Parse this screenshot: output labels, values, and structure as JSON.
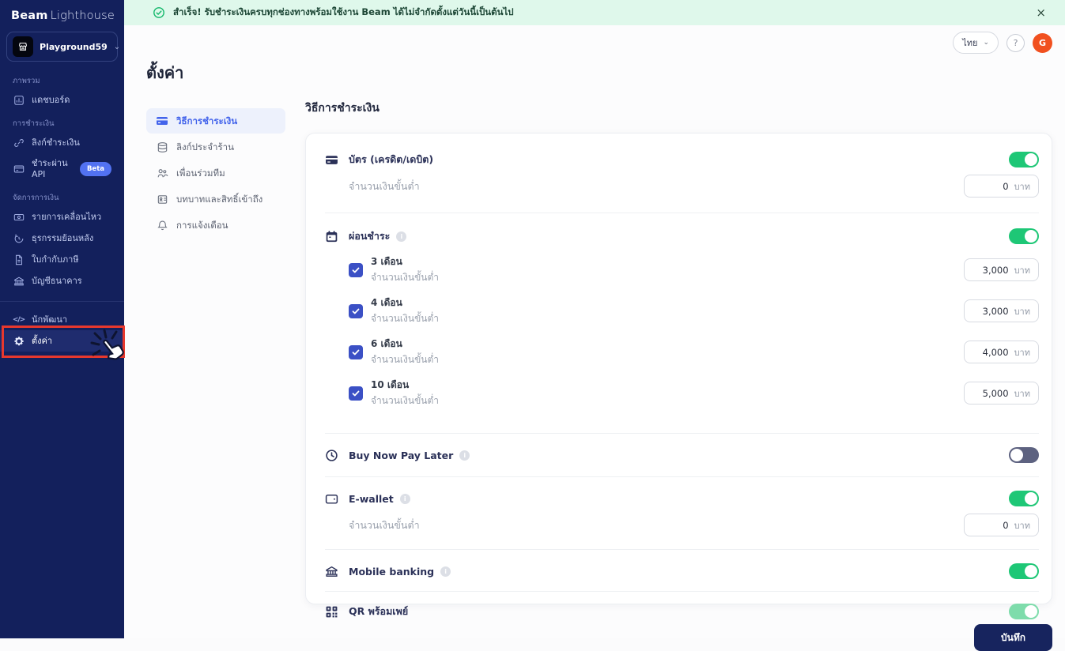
{
  "sidebar": {
    "brand": {
      "name_bold": "Beam",
      "name_light": "Lighthouse"
    },
    "workspace": {
      "name": "Playground59"
    },
    "sections": [
      {
        "label": "ภาพรวม",
        "items": [
          {
            "label": "แดชบอร์ด"
          }
        ]
      },
      {
        "label": "การชำระเงิน",
        "items": [
          {
            "label": "ลิงก์ชำระเงิน"
          },
          {
            "label": "ชำระผ่าน API",
            "badge": "Beta"
          }
        ]
      },
      {
        "label": "จัดการการเงิน",
        "items": [
          {
            "label": "รายการเคลื่อนไหว"
          },
          {
            "label": "ธุรกรรมย้อนหลัง"
          },
          {
            "label": "ใบกำกับภาษี"
          },
          {
            "label": "บัญชีธนาคาร"
          }
        ]
      }
    ],
    "footer_items": [
      {
        "label": "นักพัฒนา"
      },
      {
        "label": "ตั้งค่า",
        "active": true
      }
    ]
  },
  "banner": {
    "message": "สำเร็จ! รับชำระเงินครบทุกช่องทางพร้อมใช้งาน Beam ได้ไม่จำกัดตั้งแต่วันนี้เป็นต้นไป",
    "close": "×"
  },
  "topbar": {
    "language": "ไทย",
    "help": "?",
    "avatar_initial": "G"
  },
  "page": {
    "title": "ตั้งค่า"
  },
  "settings_nav": {
    "items": [
      {
        "label": "วิธีการชำระเงิน",
        "active": true
      },
      {
        "label": "ลิงก์ประจำร้าน"
      },
      {
        "label": "เพื่อนร่วมทีม"
      },
      {
        "label": "บทบาทและสิทธิ์เข้าถึง"
      },
      {
        "label": "การแจ้งเตือน"
      }
    ]
  },
  "payment_settings": {
    "heading": "วิธีการชำระเงิน",
    "min_amount_label": "จำนวนเงินขั้นต่ำ",
    "currency": "บาท",
    "card": {
      "title": "บัตร (เครดิต/เดบิต)",
      "min_amount": "0",
      "enabled": true
    },
    "installment": {
      "title": "ผ่อนชำระ",
      "enabled": true,
      "options": [
        {
          "label": "3 เดือน",
          "min_amount": "3,000",
          "checked": true
        },
        {
          "label": "4 เดือน",
          "min_amount": "3,000",
          "checked": true
        },
        {
          "label": "6 เดือน",
          "min_amount": "4,000",
          "checked": true
        },
        {
          "label": "10 เดือน",
          "min_amount": "5,000",
          "checked": true
        }
      ]
    },
    "bnpl": {
      "title": "Buy Now Pay Later",
      "enabled": false
    },
    "ewallet": {
      "title": "E-wallet",
      "min_amount": "0",
      "enabled": true
    },
    "mobile_banking": {
      "title": "Mobile banking",
      "enabled": true
    },
    "qr_promptpay": {
      "title": "QR พร้อมเพย์",
      "enabled": true
    },
    "save_label": "บันทึก"
  },
  "colors": {
    "sidebar_bg": "#13205c",
    "accent_blue": "#4263eb",
    "toggle_on_green": "#1ec776",
    "toggle_off_slate": "#5d6280",
    "toggle_on_light_green": "#7edcab",
    "banner_bg": "#dff8eb",
    "banner_check_green": "#12b76a",
    "avatar_orange": "#f1501f",
    "annotation_red": "#e8382d",
    "save_button_navy": "#17245e",
    "checkbox_blue": "#3b50c5"
  }
}
